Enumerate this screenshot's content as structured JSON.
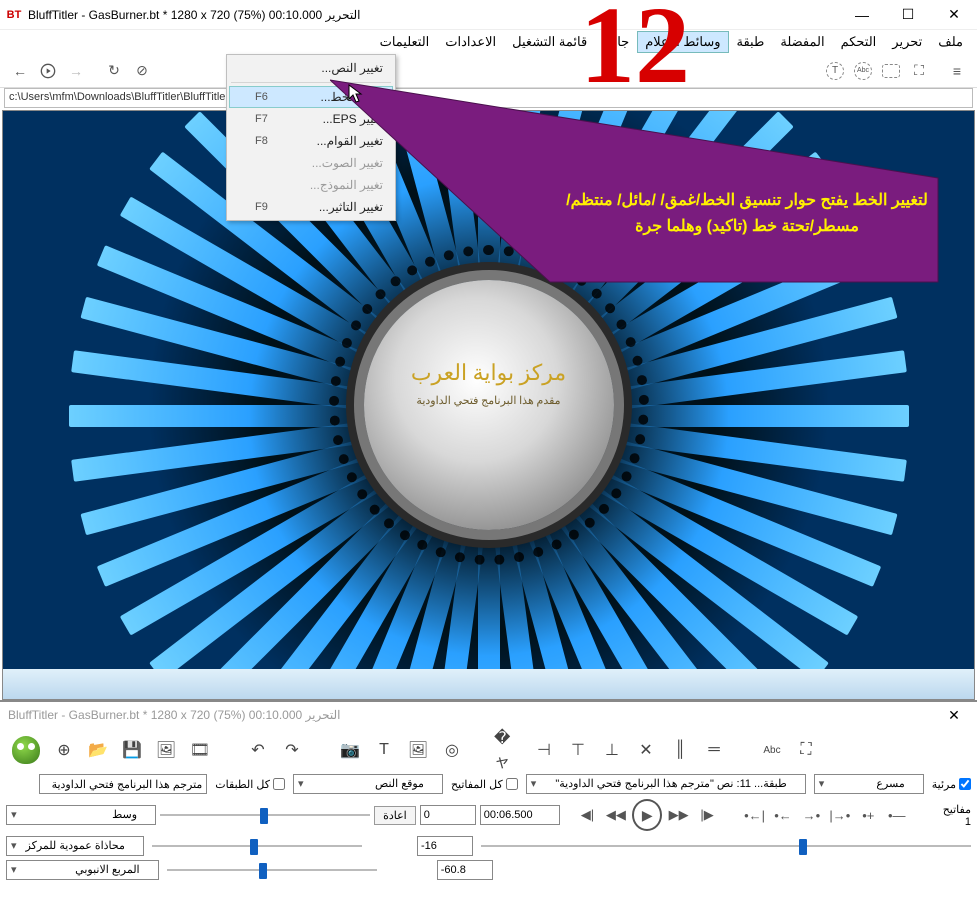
{
  "window": {
    "app_logo": "BT",
    "title": "BluffTitler - GasBurner.bt * 1280 x 720 (75%) 00:10.000 التحرير"
  },
  "menubar": [
    "ملف",
    "تحرير",
    "التحكم",
    "المفضلة",
    "طبقة",
    "وسائط الاعلام",
    "جاهز",
    "قائمة التشغيل",
    "الاعدادات",
    "التعليمات"
  ],
  "active_menu_index": 5,
  "pathbar": "c:\\Users\\mfm\\Downloads\\BluffTitler\\BluffTitle",
  "dropdown": {
    "items": [
      {
        "label": "تغيير النص...",
        "shortcut": "",
        "disabled": false
      },
      {
        "label": "تغيير الخط...",
        "shortcut": "F6",
        "disabled": false,
        "hover": true
      },
      {
        "label": "تغيير EPS...",
        "shortcut": "F7",
        "disabled": false
      },
      {
        "label": "تغيير القوام...",
        "shortcut": "F8",
        "disabled": false
      },
      {
        "label": "تغيير الصوت...",
        "shortcut": "",
        "disabled": true
      },
      {
        "label": "تغيير النموذج...",
        "shortcut": "",
        "disabled": true
      },
      {
        "label": "تغيير التاثير...",
        "shortcut": "F9",
        "disabled": false
      }
    ],
    "sep_after": [
      0
    ]
  },
  "big_number": "12",
  "callout": {
    "text": "لتغيير الخط يفتح حوار تنسيق الخط/غمق/ /مائل/ منتظم/مسطر/تحتة خط (تاكيد) وهلما جرة"
  },
  "hub": {
    "line1": "مركز  بواية  العرب",
    "line2": "مقدم هذا البرنامج فتحي الداودية"
  },
  "bottom": {
    "title": "BluffTitler - GasBurner.bt * 1280 x 720 (75%) 00:10.000 التحرير",
    "visible_label": "مرئية",
    "speed_dd": "مسرع",
    "layer_dd": "طبقة... 11: نص \"مترجم هذا البرنامج فتحي الداودية\"",
    "allkeys_label": "كل المفاتيح",
    "alllayers_label": "كل الطبقات",
    "translator_box": "مترجم هذا البرنامج فتحي الداودية",
    "keys_label": "مفاتيح 1",
    "time_value": "00:06.500",
    "reset_btn": "اعادة",
    "prop_dd": "موقع النص",
    "val0": "0",
    "val1": "-16",
    "val2": "-60.8",
    "left_dd0": "وسط",
    "left_dd1": "محاذاة عمودية للمركز",
    "left_dd2": "المربع الانبوبي"
  }
}
